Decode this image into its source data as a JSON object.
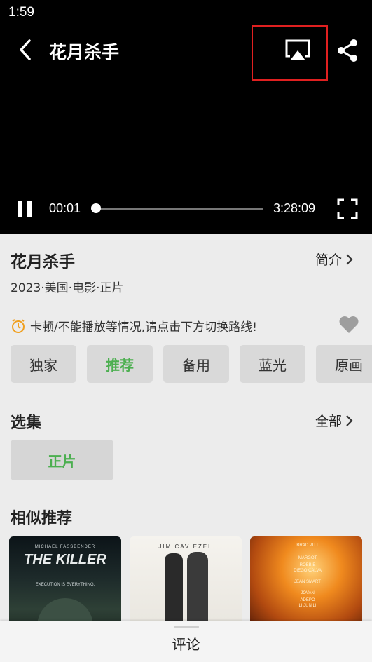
{
  "status_bar": {
    "time": "1:59"
  },
  "player": {
    "title": "花月杀手",
    "current_time": "00:01",
    "duration": "3:28:09",
    "progress": 0.0
  },
  "info": {
    "title": "花月杀手",
    "intro_label": "简介",
    "meta": "2023·美国·电影·正片"
  },
  "notice": {
    "text": "卡顿/不能播放等情况,请点击下方切换路线!"
  },
  "lines": [
    {
      "label": "独家",
      "active": false
    },
    {
      "label": "推荐",
      "active": true
    },
    {
      "label": "备用",
      "active": false
    },
    {
      "label": "蓝光",
      "active": false
    },
    {
      "label": "原画",
      "active": false
    }
  ],
  "episodes": {
    "title": "选集",
    "all_label": "全部",
    "items": [
      {
        "label": "正片"
      }
    ]
  },
  "recommend": {
    "title": "相似推荐",
    "posters": [
      {
        "top": "MICHAEL FASSBENDER",
        "main": "THE KILLER",
        "sub": "EXECUTION IS EVERYTHING."
      },
      {
        "top": "JIM CAVIEZEL"
      },
      {
        "names": [
          "BRAD PITT",
          "MARGOT ROBBIE",
          "DIEGO CALVA",
          "JEAN SMART",
          "JOVAN ADEPO",
          "LI JUN LI"
        ]
      }
    ]
  },
  "bottom_bar": {
    "label": "评论"
  },
  "colors": {
    "accent": "#4caf50",
    "highlight_box": "#e02020",
    "notice_icon": "#f0a020"
  }
}
